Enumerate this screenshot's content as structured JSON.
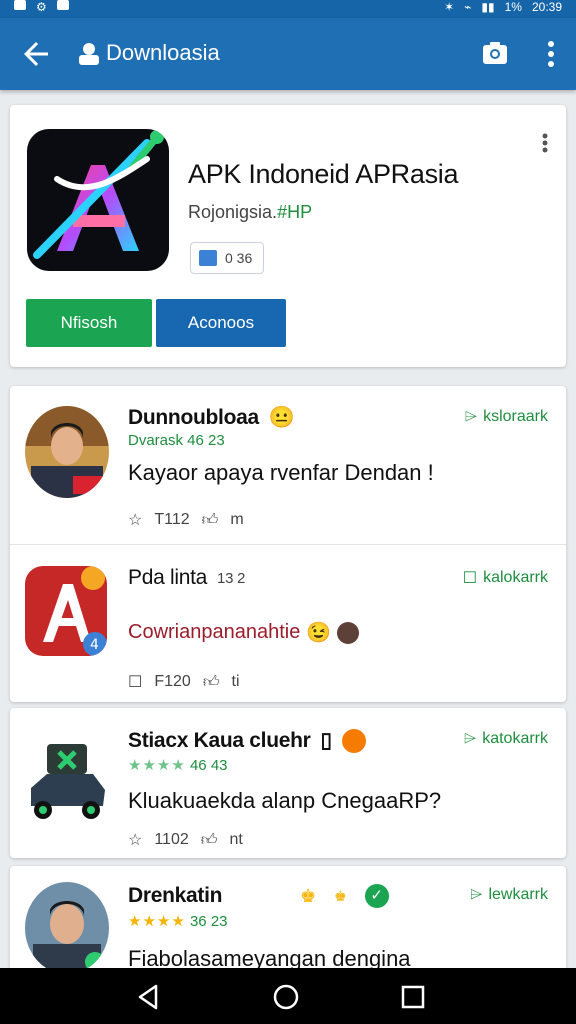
{
  "status_bar": {
    "time": "20:39",
    "battery": "1%"
  },
  "app_bar": {
    "title": "Downloasia",
    "back_icon": "arrow-back-icon",
    "camera_icon": "camera-icon",
    "menu_icon": "more-vert-icon"
  },
  "app": {
    "name": "APK Indoneid APRasia",
    "developer": "Rojonigsia.",
    "developer_tag": "#HP",
    "size": "0 36",
    "button_primary": "Nfisosh",
    "button_secondary": "Aconoos"
  },
  "reviews": [
    {
      "name": "Dunnoubloaa",
      "emoji": "😐",
      "date": "Dvarask 46 23",
      "text": "Kayaor apaya rvenfar Dendan !",
      "bookmark": "ksloraark",
      "likes": "T112",
      "reply": "m"
    },
    {
      "name": "Pda linta",
      "sub": "13 2",
      "text": "Cowrianpananahtie",
      "bookmark": "kalokarrk",
      "likes": "F120",
      "reply": "ti"
    },
    {
      "name": "Stiacx Kaua cluehr",
      "date": "46 43",
      "text": "Kluakuaekda alanp CnegaaRP?",
      "bookmark": "katokarrk",
      "likes": "1102",
      "reply": "nt"
    },
    {
      "name": "Drenkatin",
      "date": "36 23",
      "text": "Fiabolasameyangan dengina",
      "bookmark": "lewkarrk"
    }
  ],
  "colors": {
    "app_bar": "#1f6fb5",
    "status_bar": "#1565a8",
    "green": "#1ba552",
    "blue": "#1768b0",
    "accent_green": "#1e8e3e"
  }
}
